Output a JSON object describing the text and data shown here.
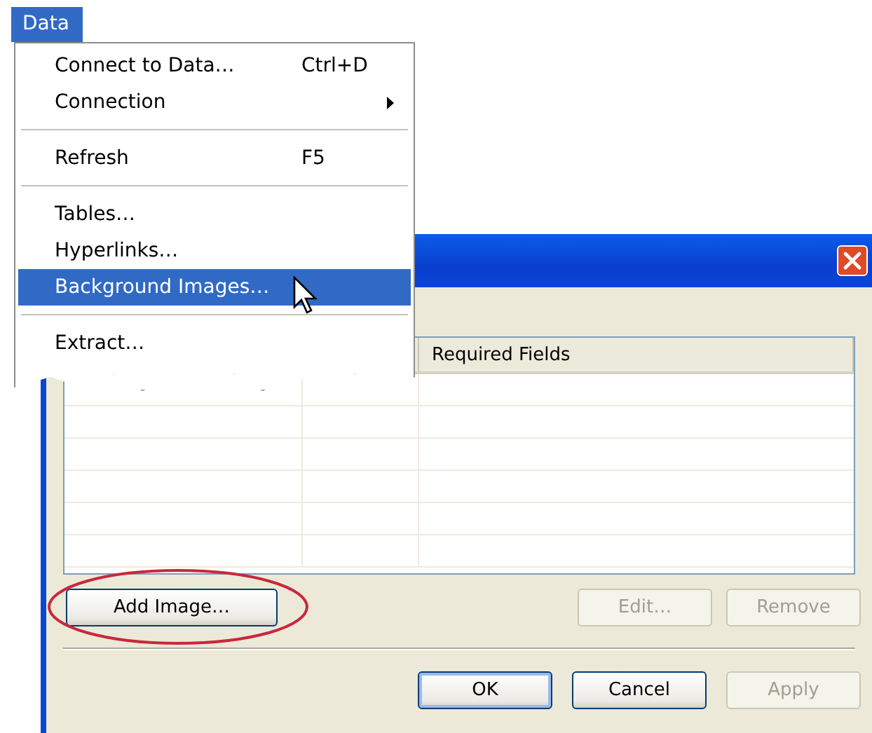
{
  "menu": {
    "title": "Data",
    "items": [
      {
        "kind": "item",
        "label": "Connect to Data…",
        "shortcut": "Ctrl+D",
        "selected": false
      },
      {
        "kind": "submenu",
        "label": "Connection",
        "selected": false
      },
      {
        "kind": "separator"
      },
      {
        "kind": "item",
        "label": "Refresh",
        "shortcut": "F5",
        "selected": false
      },
      {
        "kind": "separator"
      },
      {
        "kind": "item",
        "label": "Tables…",
        "selected": false
      },
      {
        "kind": "item",
        "label": "Hyperlinks…",
        "selected": false
      },
      {
        "kind": "item",
        "label": "Background Images…",
        "selected": true
      },
      {
        "kind": "separator"
      },
      {
        "kind": "item",
        "label": "Extract…",
        "selected": false
      }
    ]
  },
  "dialog": {
    "columns": [
      {
        "label": "Required Fields"
      }
    ],
    "list_buttons": [
      {
        "label": "Add Image…",
        "disabled": false,
        "circled": true
      },
      {
        "label": "Edit…",
        "disabled": true,
        "circled": false
      },
      {
        "label": "Remove",
        "disabled": true,
        "circled": false
      }
    ],
    "footer_buttons": [
      {
        "label": "OK",
        "disabled": false
      },
      {
        "label": "Cancel",
        "disabled": false
      },
      {
        "label": "Apply",
        "disabled": true
      }
    ]
  }
}
